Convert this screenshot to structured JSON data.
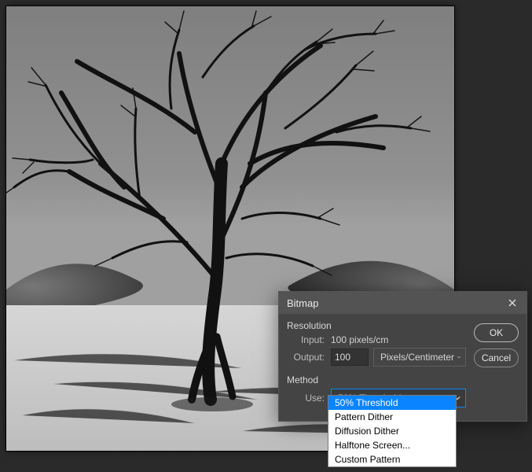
{
  "canvas": {
    "alt": "Black and white photograph of a bare tree in a desert salt pan"
  },
  "dialog": {
    "title": "Bitmap",
    "close_label": "Close",
    "resolution": {
      "heading": "Resolution",
      "input_label": "Input:",
      "input_value": "100 pixels/cm",
      "output_label": "Output:",
      "output_value": "100",
      "units_selected": "Pixels/Centimeter"
    },
    "method": {
      "heading": "Method",
      "use_label": "Use:",
      "use_selected": "50% Threshold",
      "options": [
        "50% Threshold",
        "Pattern Dither",
        "Diffusion Dither",
        "Halftone Screen...",
        "Custom Pattern"
      ]
    },
    "buttons": {
      "ok": "OK",
      "cancel": "Cancel"
    }
  }
}
